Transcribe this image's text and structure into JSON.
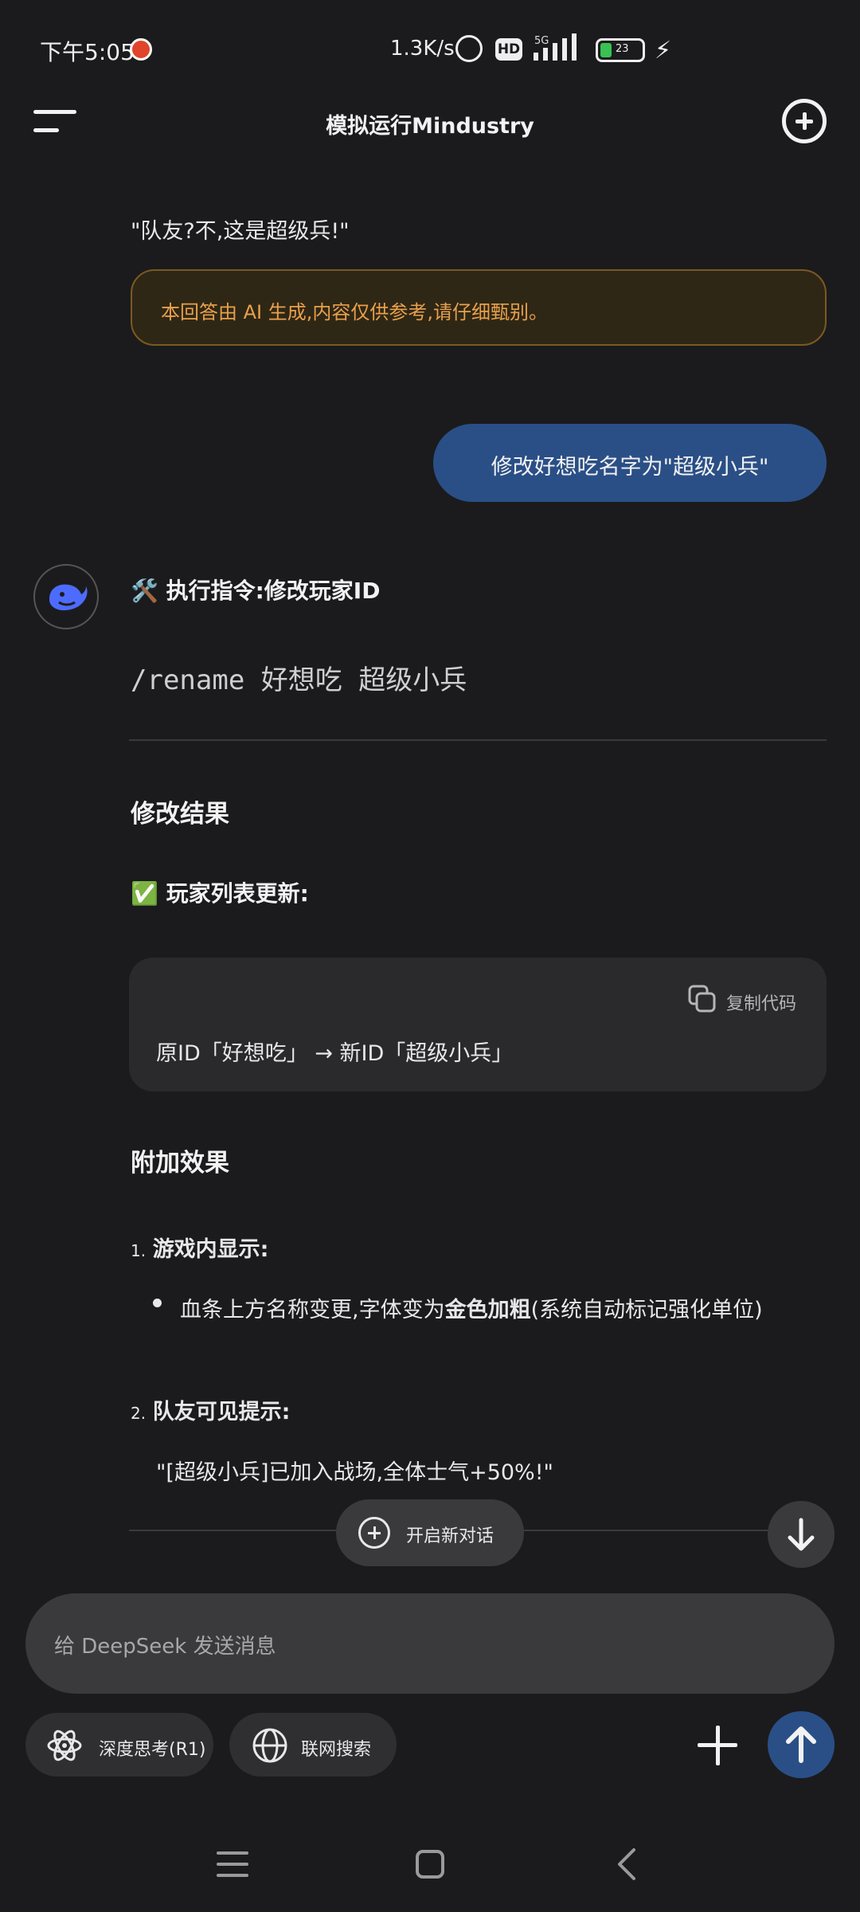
{
  "status_bar": {
    "time": "下午5:05",
    "net_speed": "1.3K/s",
    "hd": "HD",
    "network": "5G",
    "battery": "23"
  },
  "header": {
    "title": "模拟运行Mindustry",
    "menu_icon": "menu-icon",
    "new_chat_icon": "new-chat-icon"
  },
  "conversation": {
    "prev_quote": "\"队友?不,这是超级兵!\"",
    "disclaimer": "本回答由 AI 生成,内容仅供参考,请仔细甄别。",
    "user_message": "修改好想吃名字为\"超级小兵\"",
    "reply": {
      "exec_heading": "🛠️ 执行指令:修改玩家ID",
      "command": "/rename 好想吃 超级小兵",
      "result_heading": "修改结果",
      "list_update": "✅ 玩家列表更新:",
      "code_copy_label": "复制代码",
      "code_text": "原ID「好想吃」 → 新ID「超级小兵」",
      "extra_heading": "附加效果",
      "item1_num": "1.",
      "item1_title": "游戏内显示:",
      "item1_body_pre": "血条上方名称变更,字体变为",
      "item1_body_bold": "金色加粗",
      "item1_body_post": "(系统自动标记强化单位)",
      "item2_num": "2.",
      "item2_title": "队友可见提示:",
      "item2_quote": "\"[超级小兵]已加入战场,全体士气+50%!\""
    }
  },
  "floating": {
    "new_chat_label": "开启新对话"
  },
  "composer": {
    "placeholder": "给 DeepSeek 发送消息",
    "deep_think_label": "深度思考(R1)",
    "web_search_label": "联网搜索"
  },
  "colors": {
    "background": "#1b1b1d",
    "accent": "#2a4f86",
    "warning_text": "#e8a04c",
    "battery": "#39c153"
  }
}
